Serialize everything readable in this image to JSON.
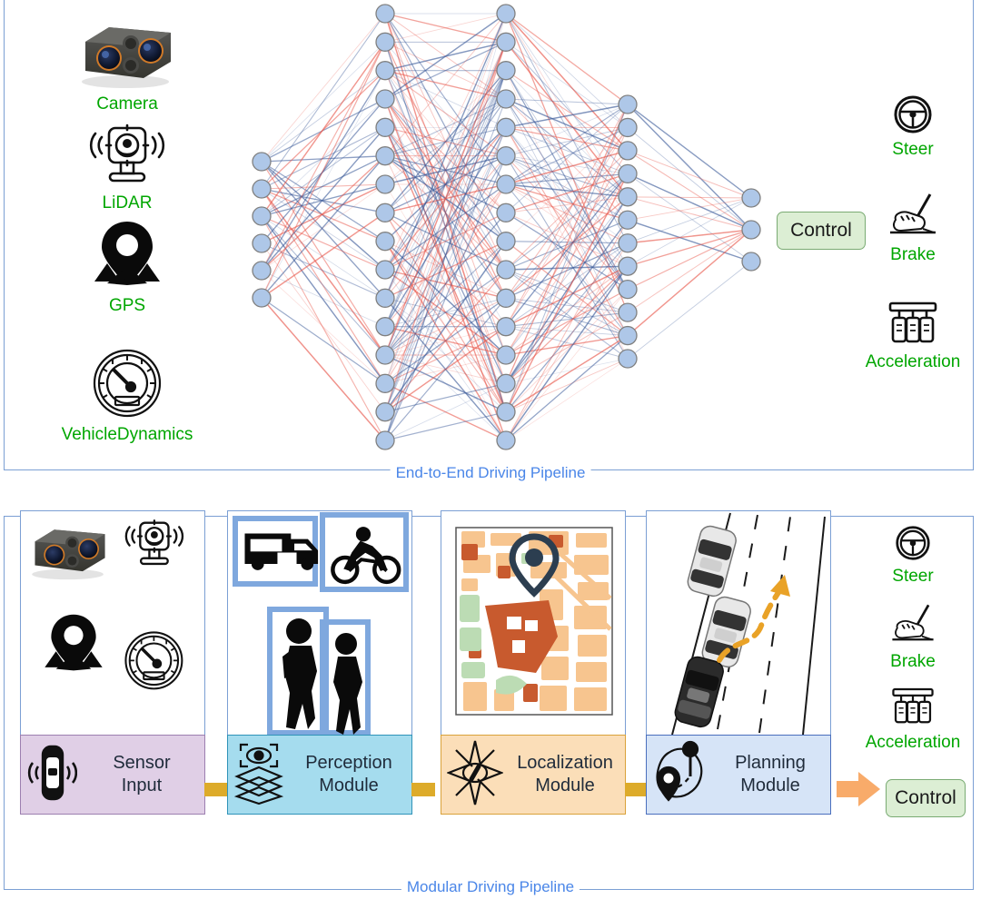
{
  "colors": {
    "accent_blue": "#4a86e8",
    "label_green": "#00a600",
    "node_fill": "#aec7e8",
    "node_stroke": "#808080",
    "edge_positive": "#3b5a99",
    "edge_negative": "#e8564a",
    "control_fill": "#dceed4",
    "control_border": "#7aab73",
    "connector_gold": "#ddab2a",
    "arrow_orange": "#f8ab6a",
    "sensor_footer": "#e0cfe6",
    "perception_footer": "#a5dcee",
    "localization_footer": "#fbdeb8",
    "planning_footer": "#d6e4f7"
  },
  "e2e": {
    "caption": "End-to-End Driving Pipeline",
    "sensors": [
      {
        "label": "Camera",
        "icon": "camera-sensor-icon"
      },
      {
        "label": "LiDAR",
        "icon": "lidar-icon"
      },
      {
        "label": "GPS",
        "icon": "gps-pin-icon"
      },
      {
        "label": "VehicleDynamics",
        "icon": "speedometer-icon"
      }
    ],
    "actuators": [
      {
        "label": "Steer",
        "icon": "steering-wheel-icon"
      },
      {
        "label": "Brake",
        "icon": "brake-pedal-icon"
      },
      {
        "label": "Acceleration",
        "icon": "pedals-icon"
      }
    ],
    "control_label": "Control"
  },
  "chart_data": {
    "type": "diagram",
    "title": "End-to-End Driving Pipeline neural network",
    "layer_sizes": [
      6,
      16,
      16,
      12,
      3
    ],
    "layer_x": [
      288,
      424,
      557,
      691,
      827
    ],
    "node_radius": 10,
    "edge_colors": [
      "#3b5a99",
      "#e8564a"
    ],
    "edge_count_approx": 700
  },
  "modular": {
    "caption": "Modular Driving Pipeline",
    "modules": [
      {
        "id": "sensor-input",
        "label": "Sensor\nInput",
        "label_line1": "Sensor",
        "label_line2": "Input",
        "footer_color": "#e0cfe6",
        "footer_border": "#9c7fb0",
        "badge_icon": "car-sensor-icon",
        "visual": "sensor-icons-grid"
      },
      {
        "id": "perception-module",
        "label_line1": "Perception",
        "label_line2": "Module",
        "footer_color": "#a5dcee",
        "footer_border": "#2f93b8",
        "badge_icon": "layers-eye-icon",
        "visual": "object-detection-boxes"
      },
      {
        "id": "localization-module",
        "label_line1": "Localization",
        "label_line2": "Module",
        "footer_color": "#fbdeb8",
        "footer_border": "#d9a23a",
        "badge_icon": "compass-icon",
        "visual": "city-map-with-pin"
      },
      {
        "id": "planning-module",
        "label_line1": "Planning",
        "label_line2": "Module",
        "footer_color": "#d6e4f7",
        "footer_border": "#4a6fbd",
        "badge_icon": "route-pin-icon",
        "visual": "lane-change-trajectory"
      }
    ],
    "outputs": [
      {
        "label": "Steer",
        "icon": "steering-wheel-icon"
      },
      {
        "label": "Brake",
        "icon": "brake-pedal-icon"
      },
      {
        "label": "Acceleration",
        "icon": "pedals-icon"
      }
    ],
    "control_label": "Control"
  }
}
